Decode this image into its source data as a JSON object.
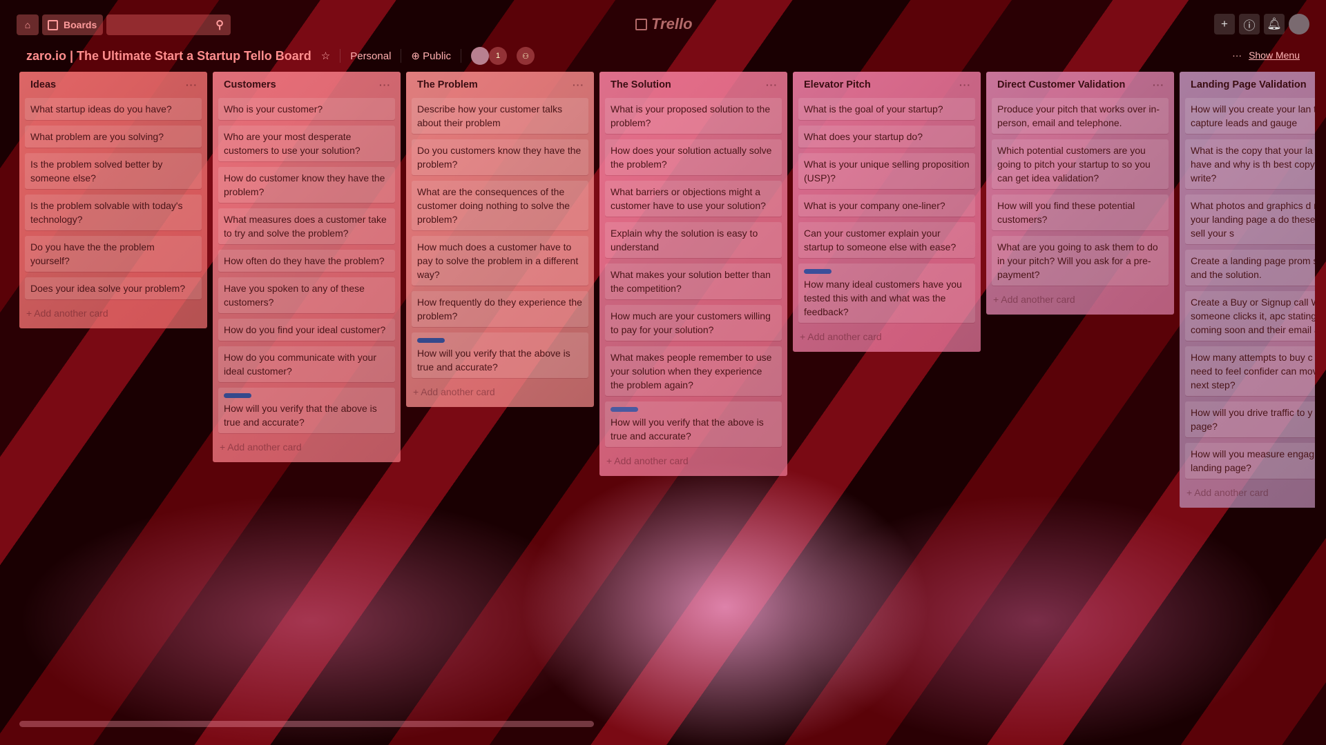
{
  "header": {
    "boards_label": "Boards",
    "search_placeholder": "",
    "logo": "Trello",
    "icons": [
      "home-icon",
      "boards-icon",
      "search-icon",
      "plus-icon",
      "info-icon",
      "bell-icon",
      "avatar"
    ]
  },
  "board": {
    "title": "zaro.io | The Ultimate Start a Startup Tello Board",
    "team": "Personal",
    "visibility": "Public",
    "member_count": "1",
    "show_menu": "Show Menu",
    "menu_dots": "···"
  },
  "lists": [
    {
      "title": "Ideas",
      "color": "#f07070",
      "cards": [
        {
          "text": "What startup ideas do you have?"
        },
        {
          "text": "What problem are you solving?"
        },
        {
          "text": "Is the problem solved better by someone else?"
        },
        {
          "text": "Is the problem solvable with today's technology?"
        },
        {
          "text": "Do you have the the problem yourself?"
        },
        {
          "text": "Does your idea solve your problem?"
        }
      ],
      "add": "+ Add another card"
    },
    {
      "title": "Customers",
      "color": "#f27a84",
      "cards": [
        {
          "text": "Who is your customer?"
        },
        {
          "text": "Who are your most desperate customers to use your solution?"
        },
        {
          "text": "How do customer know they have the problem?"
        },
        {
          "text": "What measures does a customer take to try and solve the problem?"
        },
        {
          "text": "How often do they have the problem?"
        },
        {
          "text": "Have you spoken to any of these customers?"
        },
        {
          "text": "How do you find your ideal customer?"
        },
        {
          "text": "How do you communicate with your ideal customer?"
        },
        {
          "text": "How will you verify that the above is true and accurate?",
          "label": "#35498c"
        }
      ],
      "add": "+ Add another card"
    },
    {
      "title": "The Problem",
      "color": "#f48a8a",
      "cards": [
        {
          "text": "Describe how your customer talks about their problem"
        },
        {
          "text": "Do you customers know they have the problem?"
        },
        {
          "text": "What are the consequences of the customer doing nothing to solve the problem?"
        },
        {
          "text": "How much does a customer have to pay to solve the problem in a different way?"
        },
        {
          "text": "How frequently do they experience the problem?"
        },
        {
          "text": "How will you verify that the above is true and accurate?",
          "label": "#35498c"
        }
      ],
      "add": "+ Add another card"
    },
    {
      "title": "The Solution",
      "color": "#f07a98",
      "cards": [
        {
          "text": "What is your proposed solution to the problem?"
        },
        {
          "text": "How does your solution actually solve the problem?"
        },
        {
          "text": "What barriers or objections might a customer have to use your solution?"
        },
        {
          "text": "Explain why the solution is easy to understand"
        },
        {
          "text": "What makes your solution better than the competition?"
        },
        {
          "text": "How much are your customers willing to pay for your solution?"
        },
        {
          "text": "What makes people remember to use your solution when they experience the problem again?"
        },
        {
          "text": "How will you verify that the above is true and accurate?",
          "label": "#4a5aa0"
        }
      ],
      "add": "+ Add another card"
    },
    {
      "title": "Elevator Pitch",
      "color": "#ea7aa0",
      "cards": [
        {
          "text": "What is the goal of your startup?"
        },
        {
          "text": "What does your startup do?"
        },
        {
          "text": "What is your unique selling proposition (USP)?"
        },
        {
          "text": "What is your company one-liner?"
        },
        {
          "text": "Can your customer explain your startup to someone else with ease?"
        },
        {
          "text": "How many ideal customers have you tested this with and what was the feedback?",
          "label": "#3a4f9a"
        }
      ],
      "add": "+ Add another card"
    },
    {
      "title": "Direct Customer Validation",
      "color": "#d880a8",
      "cards": [
        {
          "text": "Produce your pitch that works over in-person, email and telephone."
        },
        {
          "text": "Which potential customers are you going to pitch your startup to so you can get idea validation?"
        },
        {
          "text": "How will you find these potential customers?"
        },
        {
          "text": "What are you going to ask them to do in your pitch? Will you ask for a pre-payment?"
        }
      ],
      "add": "+ Add another card"
    },
    {
      "title": "Landing Page Validation",
      "color": "#b889b0",
      "cards": [
        {
          "text": "How will you create your lan to capture leads and gauge"
        },
        {
          "text": "What is the copy that your la page will have and why is th best copy you can write?"
        },
        {
          "text": "What photos and graphics d need for your landing page a do these help you sell your s"
        },
        {
          "text": "Create a landing page prom startup and the solution."
        },
        {
          "text": "Create a Buy or Signup call When someone clicks it, apc stating it's coming soon and their email address."
        },
        {
          "text": "How many attempts to buy c do you need to feel confider can move to the next step?"
        },
        {
          "text": "How will you drive traffic to y landing page?"
        },
        {
          "text": "How will you measure engag your landing page?"
        }
      ],
      "add": "+ Add another card"
    }
  ]
}
